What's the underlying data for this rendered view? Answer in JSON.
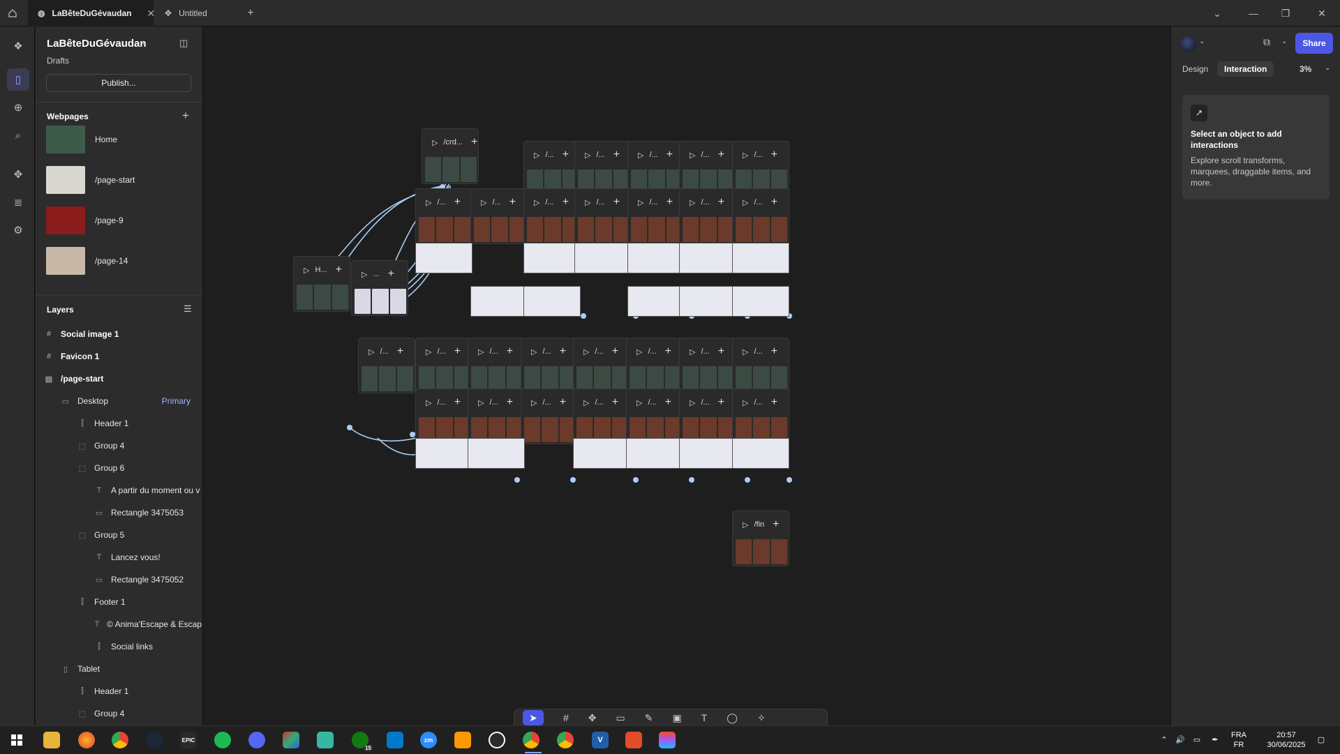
{
  "titlebar": {
    "tabs": [
      {
        "label": "LaBêteDuGévaudan",
        "active": true
      },
      {
        "label": "Untitled",
        "active": false
      }
    ],
    "new_tab": "+"
  },
  "project": {
    "name": "LaBêteDuGévaudan",
    "location": "Drafts",
    "publish_label": "Publish..."
  },
  "webpages": {
    "heading": "Webpages",
    "add": "+",
    "items": [
      {
        "label": "Home",
        "thumb_color": "#3e5a4a"
      },
      {
        "label": "/page-start",
        "thumb_color": "#d8d8d0"
      },
      {
        "label": "/page-9",
        "thumb_color": "#8a1c1c"
      },
      {
        "label": "/page-14",
        "thumb_color": "#c7b8a8"
      }
    ]
  },
  "layers": {
    "heading": "Layers",
    "items": [
      {
        "label": "Social image 1",
        "indent": 0,
        "bold": true,
        "icon": "#"
      },
      {
        "label": "Favicon 1",
        "indent": 0,
        "bold": true,
        "icon": "#"
      },
      {
        "label": "/page-start",
        "indent": 0,
        "bold": true,
        "icon": "▤"
      },
      {
        "label": "Desktop",
        "indent": 1,
        "bold": false,
        "icon": "▭",
        "badge": "Primary"
      },
      {
        "label": "Header 1",
        "indent": 2,
        "bold": false,
        "icon": "⫿"
      },
      {
        "label": "Group 4",
        "indent": 2,
        "bold": false,
        "icon": "⬚"
      },
      {
        "label": "Group 6",
        "indent": 2,
        "bold": false,
        "icon": "⬚"
      },
      {
        "label": "A partir du moment ou v",
        "indent": 3,
        "bold": false,
        "icon": "T"
      },
      {
        "label": "Rectangle 3475053",
        "indent": 3,
        "bold": false,
        "icon": "▭"
      },
      {
        "label": "Group 5",
        "indent": 2,
        "bold": false,
        "icon": "⬚"
      },
      {
        "label": "Lancez vous!",
        "indent": 3,
        "bold": false,
        "icon": "T"
      },
      {
        "label": "Rectangle 3475052",
        "indent": 3,
        "bold": false,
        "icon": "▭"
      },
      {
        "label": "Footer 1",
        "indent": 2,
        "bold": false,
        "icon": "⫿"
      },
      {
        "label": "© Anima'Escape & Escap",
        "indent": 3,
        "bold": false,
        "icon": "T"
      },
      {
        "label": "Social links",
        "indent": 3,
        "bold": false,
        "icon": "⫿"
      },
      {
        "label": "Tablet",
        "indent": 1,
        "bold": false,
        "icon": "▯"
      },
      {
        "label": "Header 1",
        "indent": 2,
        "bold": false,
        "icon": "⫿"
      },
      {
        "label": "Group 4",
        "indent": 2,
        "bold": false,
        "icon": "⬚"
      }
    ]
  },
  "canvas": {
    "frames": [
      {
        "label": "/crd...",
        "style": "dark"
      },
      {
        "label": "H...",
        "style": "dark"
      },
      {
        "label": "...",
        "style": "light"
      },
      {
        "label": "/...",
        "style": "warm"
      },
      {
        "label": "/...",
        "style": "warm"
      },
      {
        "label": "/...",
        "style": "dark"
      },
      {
        "label": "/...",
        "style": "dark"
      },
      {
        "label": "/...",
        "style": "dark"
      },
      {
        "label": "/...",
        "style": "dark"
      },
      {
        "label": "/...",
        "style": "dark"
      },
      {
        "label": "/...",
        "style": "warm"
      },
      {
        "label": "/...",
        "style": "warm"
      },
      {
        "label": "/...",
        "style": "warm"
      },
      {
        "label": "/...",
        "style": "warm"
      },
      {
        "label": "/...",
        "style": "warm"
      },
      {
        "label": "/...",
        "style": "dark"
      },
      {
        "label": "/...",
        "style": "dark"
      },
      {
        "label": "/...",
        "style": "dark"
      },
      {
        "label": "/...",
        "style": "dark"
      },
      {
        "label": "/...",
        "style": "dark"
      },
      {
        "label": "/...",
        "style": "dark"
      },
      {
        "label": "/...",
        "style": "dark"
      },
      {
        "label": "/...",
        "style": "dark"
      },
      {
        "label": "/...",
        "style": "warm"
      },
      {
        "label": "/...",
        "style": "warm"
      },
      {
        "label": "/...",
        "style": "warm"
      },
      {
        "label": "/...",
        "style": "warm"
      },
      {
        "label": "/...",
        "style": "warm"
      },
      {
        "label": "/...",
        "style": "warm"
      },
      {
        "label": "/...",
        "style": "warm"
      },
      {
        "label": "/fin",
        "style": "warm"
      }
    ]
  },
  "toolbar": {
    "tools": [
      "select-tool",
      "frame-tool",
      "component-tool",
      "rectangle-tool",
      "pen-tool",
      "image-tool",
      "text-tool",
      "comment-tool",
      "effects-tool"
    ]
  },
  "right": {
    "share_label": "Share",
    "tabs": [
      {
        "label": "Design",
        "active": false
      },
      {
        "label": "Interaction",
        "active": true
      }
    ],
    "zoom": "3%",
    "card": {
      "title": "Select an object to add interactions",
      "body": "Explore scroll transforms, marquees, draggable items, and more."
    }
  },
  "taskbar": {
    "lang_top": "FRA",
    "lang_bottom": "FR",
    "time": "20:57",
    "date": "30/06/2025",
    "xbox_badge": "15"
  },
  "colors": {
    "accent": "#4c57e6",
    "link": "#a9cdf5",
    "canvas_bg": "#1e1e1e",
    "panel_bg": "#2c2c2c"
  }
}
